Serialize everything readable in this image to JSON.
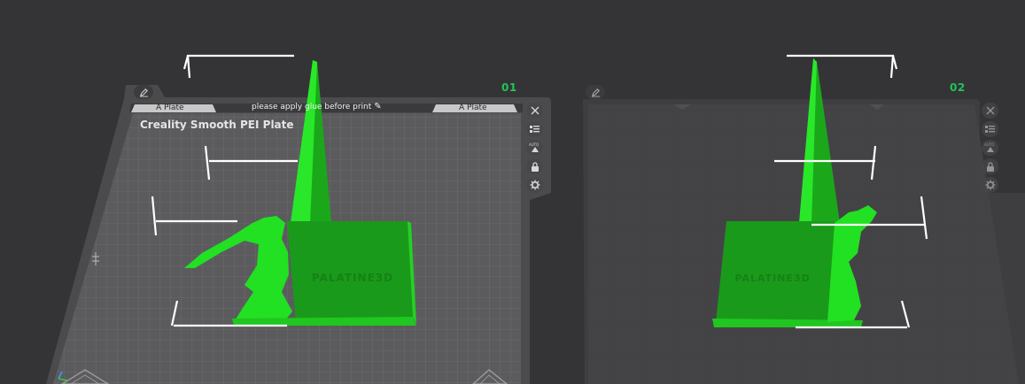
{
  "plates": [
    {
      "index_label": "01",
      "bed_label": "Creality Smooth PEI Plate",
      "left_tab": "A Plate",
      "right_tab": "A Plate",
      "notice": "please apply glue before print",
      "model_text": "PALATINE3D",
      "tools": [
        "close-icon",
        "arrange-icon",
        "auto-orient-icon",
        "lock-icon",
        "settings-icon"
      ],
      "edit_icon": "pencil-icon"
    },
    {
      "index_label": "02",
      "model_text": "PALATINE3D",
      "tools": [
        "close-icon",
        "arrange-icon",
        "auto-orient-icon",
        "lock-icon",
        "settings-icon"
      ],
      "edit_icon": "pencil-icon"
    }
  ],
  "tool_labels": {
    "auto": "AUTO"
  },
  "colors": {
    "background": "#343437",
    "active_bed": "#5b5b5e",
    "inactive_bed": "#3e3e41",
    "model": "#1fdd1f",
    "accent": "#22c35a"
  }
}
